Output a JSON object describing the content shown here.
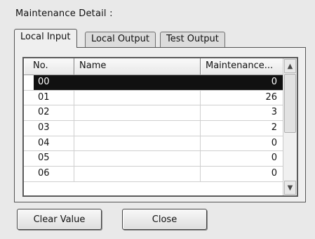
{
  "group": {
    "title": "Maintenance Detail :"
  },
  "tabs": [
    {
      "label": "Local Input",
      "active": true
    },
    {
      "label": "Local Output",
      "active": false
    },
    {
      "label": "Test Output",
      "active": false
    }
  ],
  "table": {
    "columns": [
      "No.",
      "Name",
      "Maintenance..."
    ],
    "rows": [
      {
        "no": "00",
        "name": "",
        "value": "0",
        "selected": true
      },
      {
        "no": "01",
        "name": "",
        "value": "26"
      },
      {
        "no": "02",
        "name": "",
        "value": "3"
      },
      {
        "no": "03",
        "name": "",
        "value": "2"
      },
      {
        "no": "04",
        "name": "",
        "value": "0"
      },
      {
        "no": "05",
        "name": "",
        "value": "0"
      },
      {
        "no": "06",
        "name": "",
        "value": "0"
      }
    ]
  },
  "scrollbar": {
    "up_icon": "chevron-up-icon",
    "down_icon": "chevron-down-icon"
  },
  "buttons": {
    "clear_label": "Clear Value",
    "close_label": "Close"
  },
  "colors": {
    "selection": "#111111",
    "panel_bg": "#efefef",
    "window_bg": "#e9e9e9"
  }
}
